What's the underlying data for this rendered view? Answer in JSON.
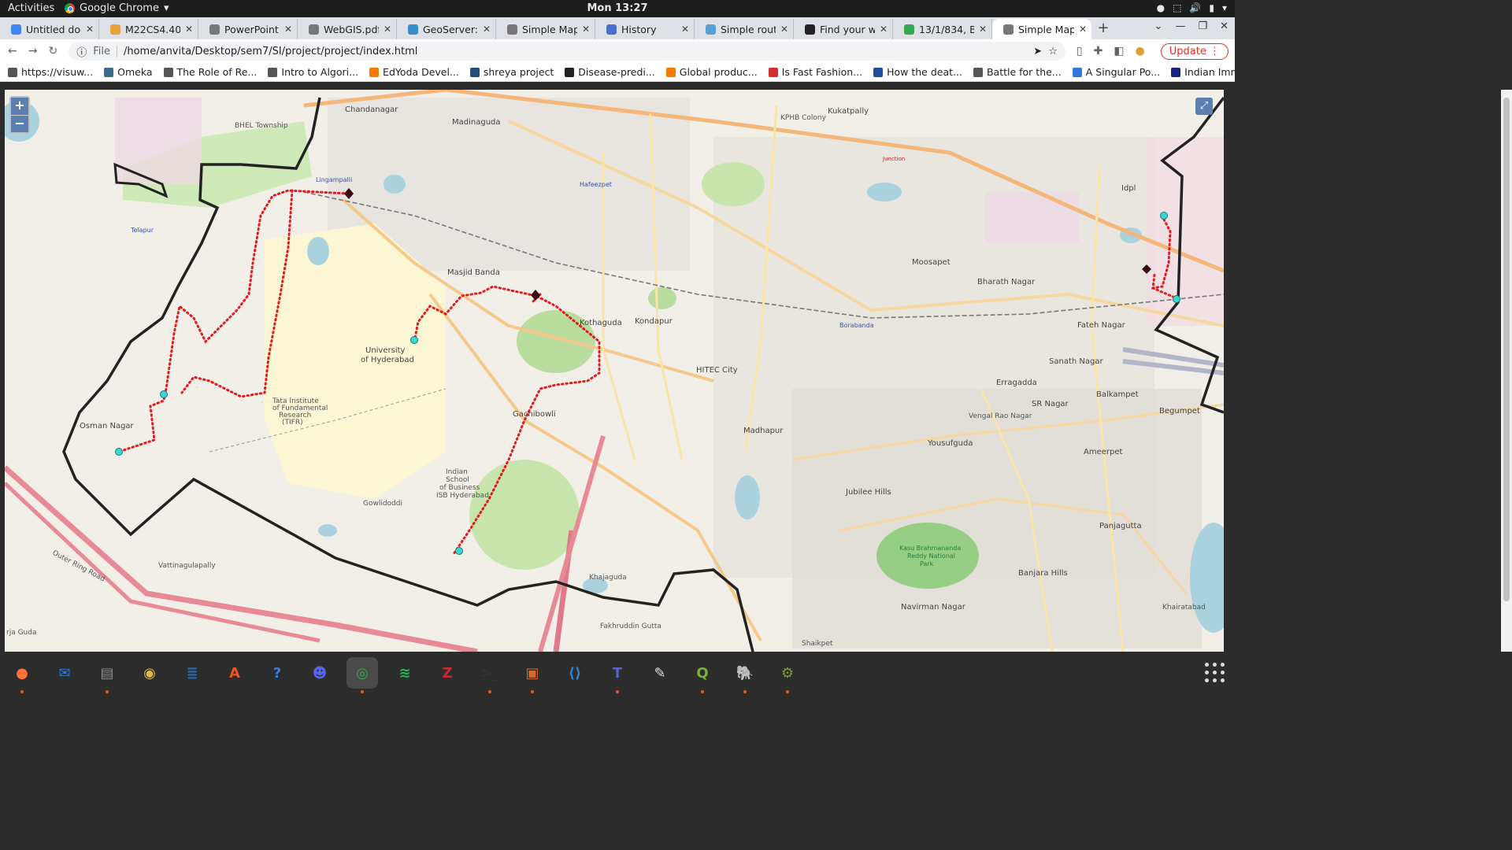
{
  "topbar": {
    "activities": "Activities",
    "app": "Google Chrome",
    "clock": "Mon 13:27"
  },
  "tabs": [
    {
      "title": "Untitled docu",
      "color": "#4285f4"
    },
    {
      "title": "M22CS4.408:",
      "color": "#e8a33d"
    },
    {
      "title": "PowerPoint F",
      "color": "#777777"
    },
    {
      "title": "WebGIS.pdf",
      "color": "#777777"
    },
    {
      "title": "GeoServer: W",
      "color": "#3a8dc8"
    },
    {
      "title": "Simple Map",
      "color": "#777777"
    },
    {
      "title": "History",
      "color": "#4a6fcf"
    },
    {
      "title": "Simple route",
      "color": "#5aa0d0"
    },
    {
      "title": "Find your wa",
      "color": "#222222"
    },
    {
      "title": "13/1/834, Ba",
      "color": "#34a853"
    },
    {
      "title": "Simple Map",
      "color": "#777777",
      "active": true
    }
  ],
  "toolbar": {
    "scheme": "File",
    "url": "/home/anvita/Desktop/sem7/SI/project/project/index.html",
    "update_label": "Update"
  },
  "bookmarks": [
    {
      "label": "https://visuw...",
      "color": "#555555"
    },
    {
      "label": "Omeka",
      "color": "#3a6d8c"
    },
    {
      "label": "The Role of Re...",
      "color": "#555555"
    },
    {
      "label": "Intro to Algori...",
      "color": "#555555"
    },
    {
      "label": "EdYoda Devel...",
      "color": "#f57c00"
    },
    {
      "label": "shreya project",
      "color": "#1f4e79"
    },
    {
      "label": "Disease-predi...",
      "color": "#222222"
    },
    {
      "label": "Global produc...",
      "color": "#f57c00"
    },
    {
      "label": "Is Fast Fashion...",
      "color": "#d32f2f"
    },
    {
      "label": "How the deat...",
      "color": "#1a4fa0"
    },
    {
      "label": "Battle for the...",
      "color": "#555555"
    },
    {
      "label": "A Singular Po...",
      "color": "#2f7ad9"
    },
    {
      "label": "Indian Immigr...",
      "color": "#1a237e"
    }
  ],
  "map": {
    "zoom_in": "+",
    "zoom_out": "−",
    "labels": {
      "chandanagar": "Chandanagar",
      "madinaguda": "Madinaguda",
      "kphb": "KPHB Colony",
      "kukatpally": "Kukatpally",
      "bhel": "BHEL Township",
      "lingampalli": "Lingampalli",
      "hafeezpet": "Hafeezpet",
      "telapur": "Telapur",
      "masjid_banda": "Masjid Banda",
      "kothaguda": "Kothaguda",
      "kondapur": "Kondapur",
      "uoh1": "University",
      "uoh2": "of Hyderabad",
      "hitec": "HITEC City",
      "gachibowli": "Gachibowli",
      "osman_nagar": "Osman Nagar",
      "gowlidoddi": "Gowlidoddi",
      "vattinagulapally": "Vattinagulapally",
      "khajaguda": "Khajaguda",
      "madhapur": "Madhapur",
      "moosapet": "Moosapet",
      "bharath_nagar": "Bharath Nagar",
      "idpl": "Idpl",
      "fateh_nagar": "Fateh Nagar",
      "sanath_nagar": "Sanath Nagar",
      "borabanda": "Borabanda",
      "erragadda": "Erragadda",
      "yousufguda": "Yousufguda",
      "jubilee_hills": "Jubilee Hills",
      "banjara_hills": "Banjara Hills",
      "panjagutta": "Panjagutta",
      "ameerpet": "Ameerpet",
      "begumpet": "Begumpet",
      "balkampet": "Balkampet",
      "sr_nagar": "SR Nagar",
      "vengal_rao": "Vengal Rao Nagar",
      "kbr1": "Kasu Brahmananda",
      "kbr2": "Reddy National",
      "kbr3": "Park",
      "navirman": "Navirman Nagar",
      "isb1": "Indian",
      "isb2": "School",
      "isb3": "of Business",
      "isb4": "ISB Hyderabad",
      "tifr1": "Tata Institute",
      "tifr2": "of Fundamental",
      "tifr3": "Research",
      "tifr4": "(TIFR)",
      "khairatabad": "Khairatabad",
      "fakhruddin": "Fakhruddin Gutta",
      "shaikpet": "Shaikpet",
      "raja_guda": "rja Guda",
      "orr": "Outer Ring Road",
      "junction": "Junction"
    }
  },
  "dock": [
    {
      "name": "firefox",
      "glyph": "●",
      "color": "#ff7139",
      "running": true
    },
    {
      "name": "thunderbird",
      "glyph": "✉",
      "color": "#2a7ad2"
    },
    {
      "name": "files",
      "glyph": "▤",
      "color": "#8d8d8d",
      "running": true
    },
    {
      "name": "rhythmbox",
      "glyph": "◉",
      "color": "#e0b44a"
    },
    {
      "name": "writer",
      "glyph": "≣",
      "color": "#2a6ab6"
    },
    {
      "name": "software",
      "glyph": "A",
      "color": "#e95420"
    },
    {
      "name": "help",
      "glyph": "?",
      "color": "#3d7bd6"
    },
    {
      "name": "discord",
      "glyph": "☻",
      "color": "#5865f2"
    },
    {
      "name": "chrome",
      "glyph": "◎",
      "color": "#34a853",
      "running": true,
      "active": true
    },
    {
      "name": "spotify",
      "glyph": "≋",
      "color": "#1db954"
    },
    {
      "name": "zotero",
      "glyph": "Z",
      "color": "#cc2936"
    },
    {
      "name": "terminal",
      "glyph": ">_",
      "color": "#333333",
      "running": true
    },
    {
      "name": "impress",
      "glyph": "▣",
      "color": "#d66a2c",
      "running": true
    },
    {
      "name": "vscode",
      "glyph": "⟨⟩",
      "color": "#2a8ad8"
    },
    {
      "name": "teams",
      "glyph": "T",
      "color": "#5b5fc7",
      "running": true
    },
    {
      "name": "text-editor",
      "glyph": "✎",
      "color": "#dedede"
    },
    {
      "name": "qgis",
      "glyph": "Q",
      "color": "#78b13f",
      "running": true
    },
    {
      "name": "pgadmin",
      "glyph": "🐘",
      "color": "#336791",
      "running": true
    },
    {
      "name": "qgis-tool",
      "glyph": "⚙",
      "color": "#7a9d3a",
      "running": true
    }
  ]
}
